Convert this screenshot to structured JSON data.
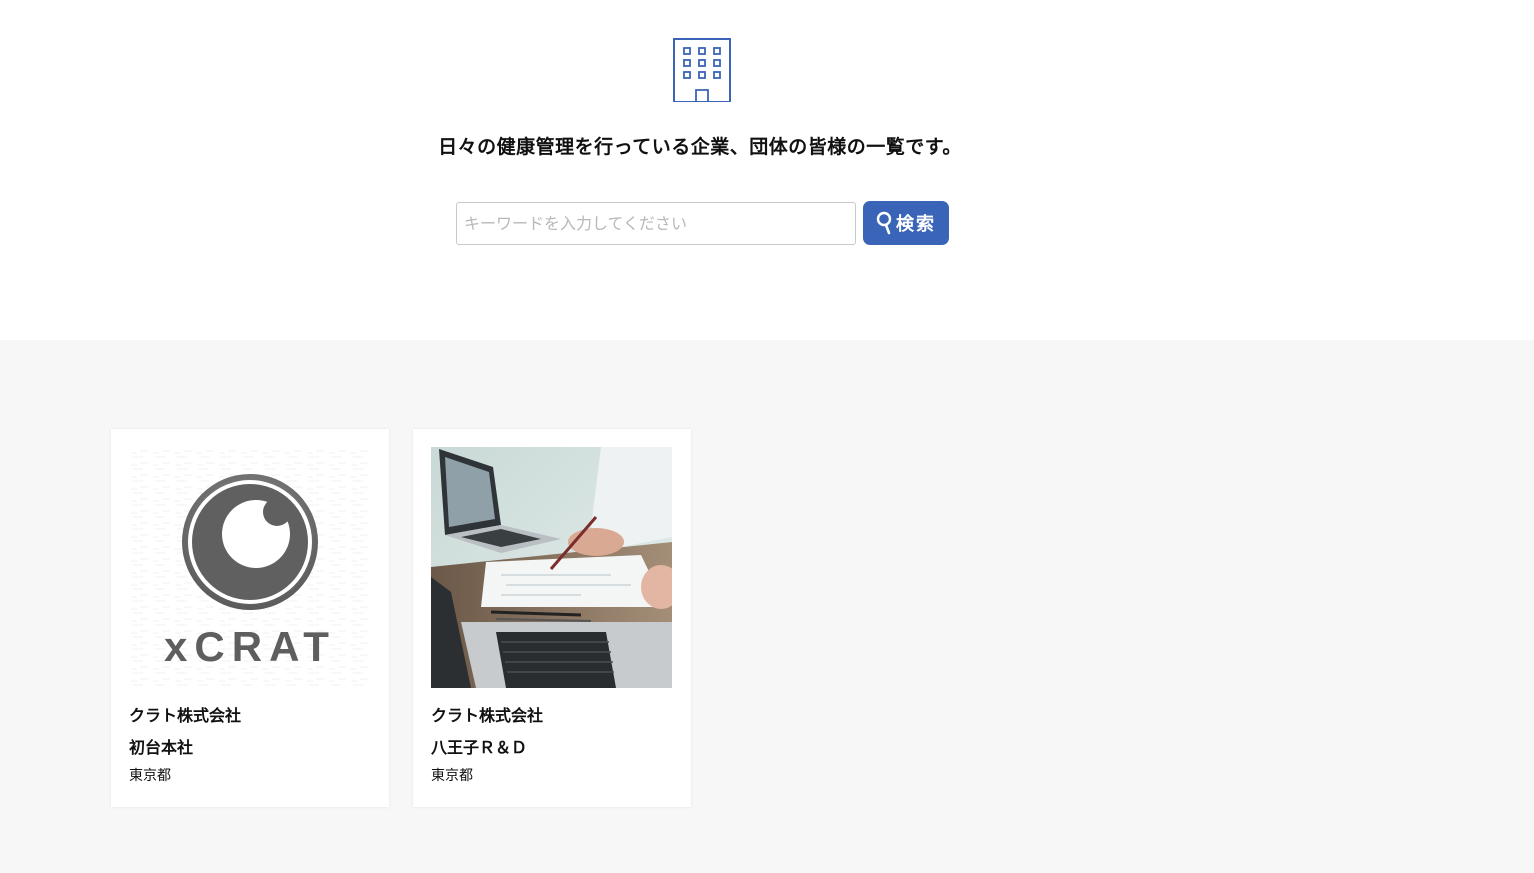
{
  "header": {
    "icon": "building-icon",
    "lead": "日々の健康管理を行っている企業、団体の皆様の一覧です。"
  },
  "search": {
    "placeholder": "キーワードを入力してください",
    "value": "",
    "button_label": "検索",
    "button_icon": "search-icon"
  },
  "colors": {
    "accent": "#3a64b7",
    "list_bg": "#f7f7f7",
    "card_bg": "#ffffff"
  },
  "companies": [
    {
      "company": "クラト株式会社",
      "branch": "初台本社",
      "prefecture": "東京都",
      "logo_text": "xCRAT"
    },
    {
      "company": "クラト株式会社",
      "branch": "八王子Ｒ＆Ｄ",
      "prefecture": "東京都"
    }
  ]
}
